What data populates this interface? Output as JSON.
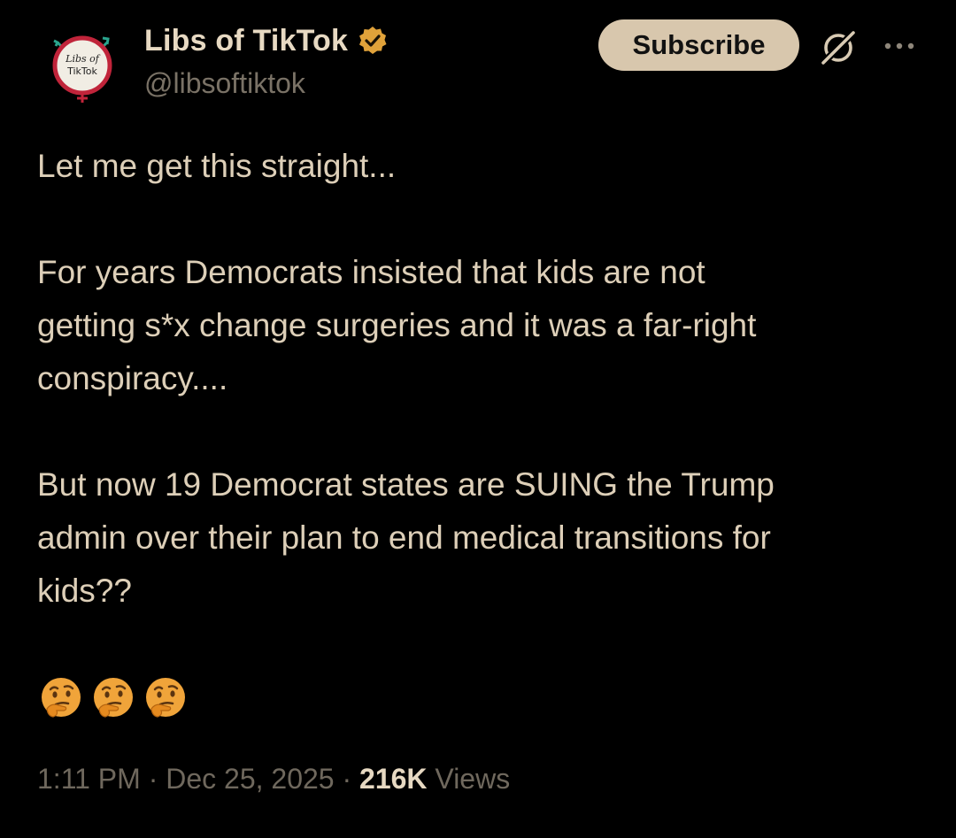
{
  "author": {
    "display_name": "Libs of TikTok",
    "handle": "@libsoftiktok",
    "verified": true,
    "avatar_text_line1": "Libs of",
    "avatar_text_line2": "TikTok",
    "verified_color": "#e0a23a"
  },
  "header": {
    "subscribe_label": "Subscribe",
    "grok_icon": "grok-icon",
    "more_icon": "more-icon"
  },
  "tweet": {
    "paragraph_1": "Let me get this straight...",
    "paragraph_2_line_1": "For years Democrats insisted that kids are not",
    "paragraph_2_line_2": "getting s*x change surgeries and it was a far-right",
    "paragraph_2_line_3": "conspiracy....",
    "paragraph_3_line_1": "But now 19 Democrat states are SUING the Trump",
    "paragraph_3_line_2": "admin over their plan to end medical transitions for",
    "paragraph_3_line_3": "kids??",
    "emojis": [
      "thinking-face",
      "thinking-face",
      "thinking-face"
    ]
  },
  "meta": {
    "time": "1:11 PM",
    "date": "Dec 25, 2025",
    "separator": "·",
    "views_count": "216K",
    "views_label": "Views"
  },
  "colors": {
    "background": "#000000",
    "text": "#ddcfb8",
    "muted": "#6f685d",
    "button_bg": "#d8c7ad"
  }
}
